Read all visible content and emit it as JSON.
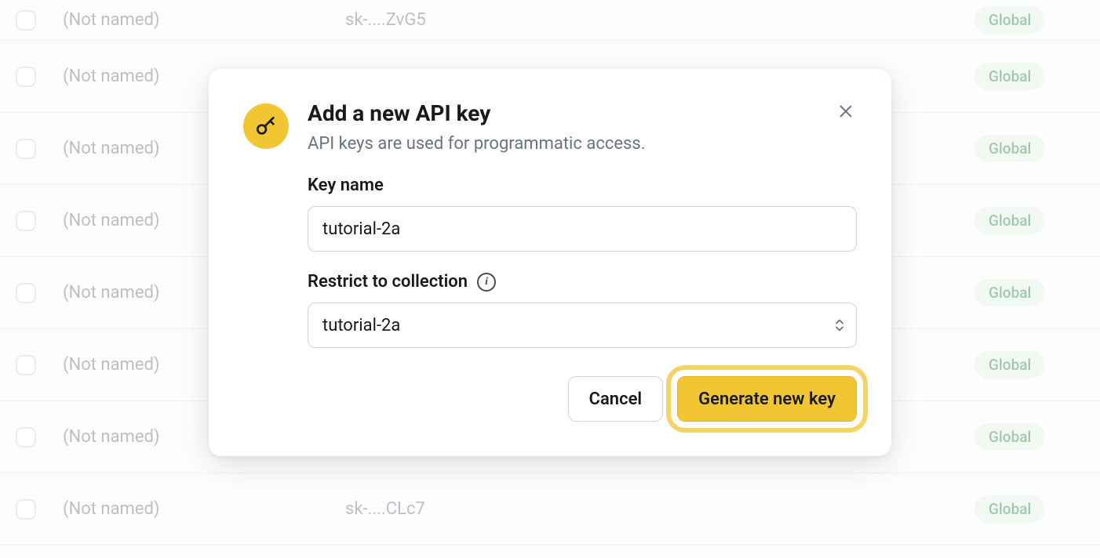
{
  "table": {
    "rows": [
      {
        "name": "(Not named)",
        "key": "sk-....ZvG5",
        "badge": "Global"
      },
      {
        "name": "(Not named)",
        "key": "",
        "badge": "Global"
      },
      {
        "name": "(Not named)",
        "key": "",
        "badge": "Global"
      },
      {
        "name": "(Not named)",
        "key": "",
        "badge": "Global"
      },
      {
        "name": "(Not named)",
        "key": "",
        "badge": "Global"
      },
      {
        "name": "(Not named)",
        "key": "",
        "badge": "Global"
      },
      {
        "name": "(Not named)",
        "key": "",
        "badge": "Global"
      },
      {
        "name": "(Not named)",
        "key": "sk-....CLc7",
        "badge": "Global"
      }
    ]
  },
  "modal": {
    "title": "Add a new API key",
    "subtitle": "API keys are used for programmatic access.",
    "key_name_label": "Key name",
    "key_name_value": "tutorial-2a",
    "collection_label": "Restrict to collection",
    "collection_value": "tutorial-2a",
    "cancel_label": "Cancel",
    "generate_label": "Generate new key"
  }
}
